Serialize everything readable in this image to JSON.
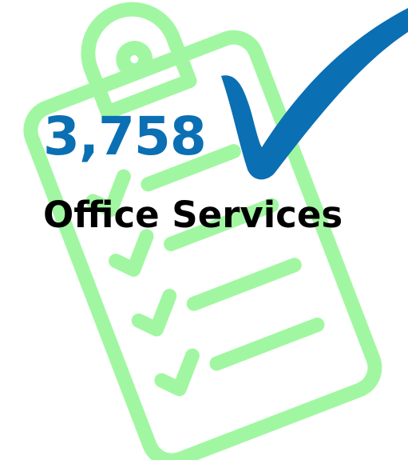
{
  "infographic": {
    "value": "3,758",
    "label": "Office Services"
  },
  "colors": {
    "clipboard": "#a1f7a1",
    "checkmark": "#0b6fb3",
    "value_text": "#0b6fb3",
    "label_text": "#000000",
    "background": "#ffffff"
  },
  "icons": {
    "clipboard": "clipboard-checklist-icon",
    "check": "checkmark-icon"
  }
}
